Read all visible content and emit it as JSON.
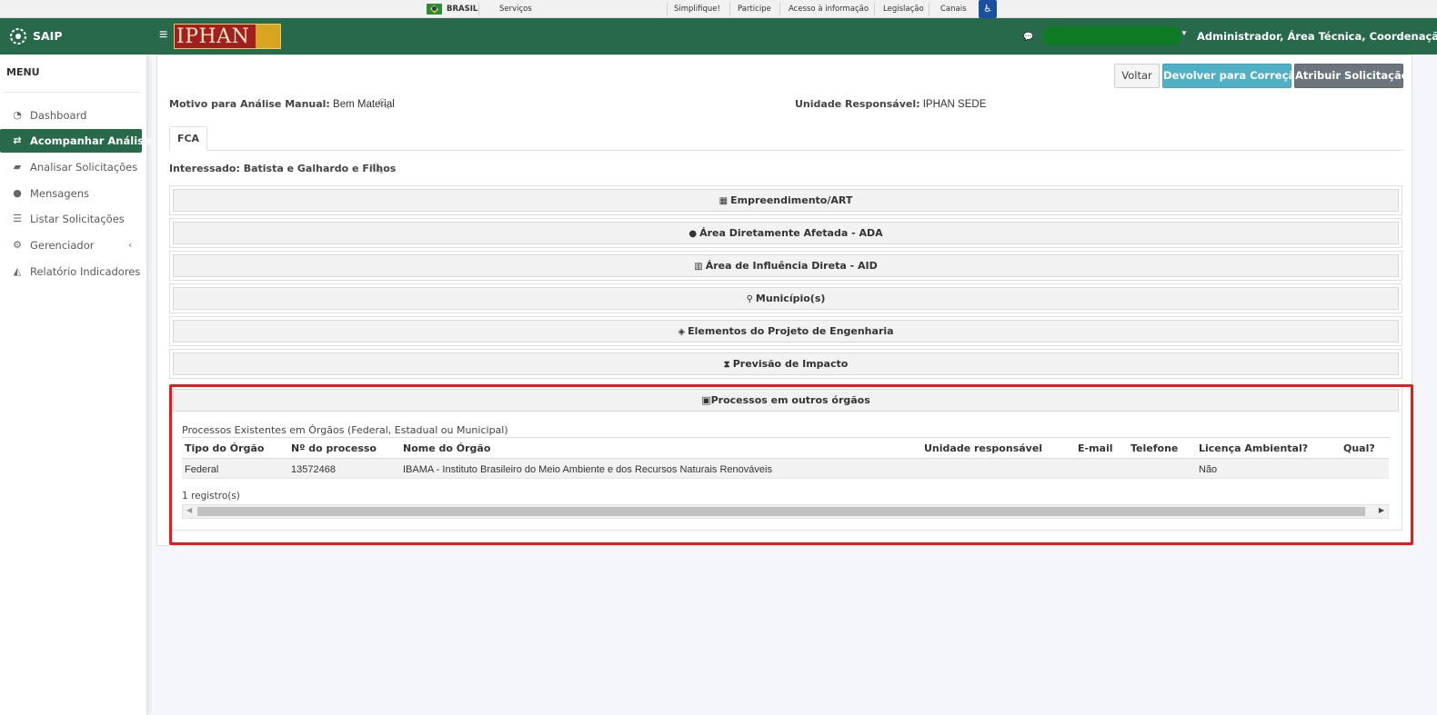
{
  "govbar": {
    "country": "BRASIL",
    "services": "Serviços",
    "links": [
      "Simplifique!",
      "Participe",
      "Acesso à informação",
      "Legislação",
      "Canais"
    ]
  },
  "header": {
    "app_name": "SAIP",
    "logo_text": "IPHAN",
    "user_role": "Administrador, Área Técnica, Coordenação..."
  },
  "sidebar": {
    "title": "MENU",
    "items": [
      {
        "label": "Dashboard",
        "icon": "dashboard-icon"
      },
      {
        "label": "Acompanhar Análise",
        "icon": "exchange-icon"
      },
      {
        "label": "Analisar Solicitações",
        "icon": "book-icon"
      },
      {
        "label": "Mensagens",
        "icon": "comments-icon"
      },
      {
        "label": "Listar Solicitações",
        "icon": "list-icon"
      },
      {
        "label": "Gerenciador",
        "icon": "cogs-icon"
      },
      {
        "label": "Relatório Indicadores",
        "icon": "area-chart-icon"
      }
    ]
  },
  "toolbar": {
    "back_label": "Voltar",
    "return_label": "Devolver para Correção",
    "assign_label": "Atribuir Solicitação"
  },
  "info": {
    "motivo_label": "Motivo para Análise Manual:",
    "motivo_value": "Bem Material",
    "unidade_label": "Unidade Responsável:",
    "unidade_value": "IPHAN SEDE"
  },
  "tabs": [
    "FCA"
  ],
  "interessado": "Interessado: Batista e Galhardo e Filhos",
  "accordion": [
    {
      "label": "Empreendimento/ART",
      "icon": "building-icon"
    },
    {
      "label": "Área Diretamente Afetada - ADA",
      "icon": "globe-icon"
    },
    {
      "label": "Área de Influência Direta - AID",
      "icon": "map-icon"
    },
    {
      "label": "Município(s)",
      "icon": "map-marker-icon"
    },
    {
      "label": "Elementos do Projeto de Engenharia",
      "icon": "cubes-icon"
    },
    {
      "label": "Previsão de Impacto",
      "icon": "hourglass-icon"
    },
    {
      "label": "Processos em outros órgãos",
      "icon": "archive-icon"
    }
  ],
  "processos": {
    "title": "Processos Existentes em Órgãos (Federal, Estadual ou Municipal)",
    "columns": [
      "Tipo do Órgão",
      "Nº do processo",
      "Nome do Órgão",
      "Unidade responsável",
      "E-mail",
      "Telefone",
      "Licença Ambiental?",
      "Qual?"
    ],
    "rows": [
      [
        "Federal",
        "13572468",
        "IBAMA - Instituto Brasileiro do Meio Ambiente e dos Recursos Naturais Renováveis",
        "",
        "",
        "",
        "Não",
        ""
      ]
    ],
    "count": "1 registro(s)"
  }
}
